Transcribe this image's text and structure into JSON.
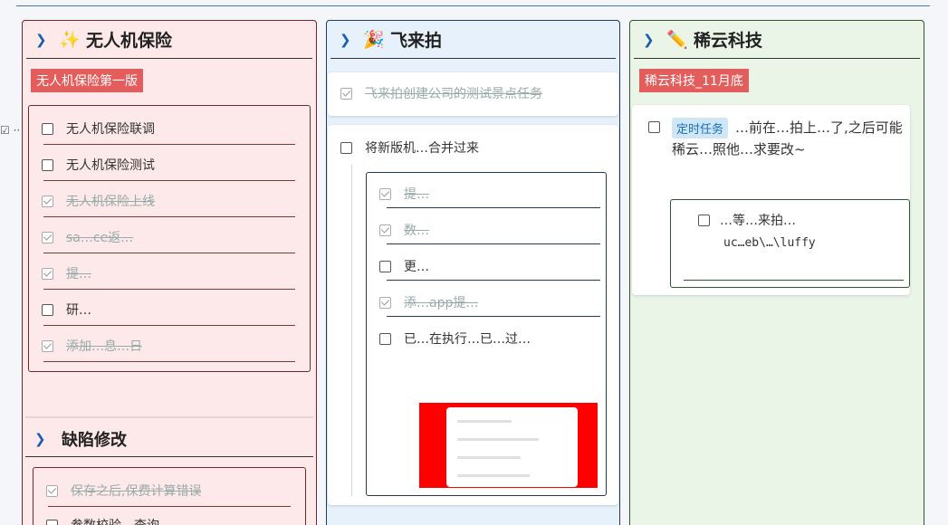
{
  "columns": [
    {
      "title": "无人机保险",
      "icon": "sparkle-icon",
      "emoji": "✨",
      "tag": "无人机保险第一版",
      "tasks": [
        {
          "label": "无人机保险联调",
          "done": false
        },
        {
          "label": "无人机保险测试",
          "done": false
        },
        {
          "label": "无人机保险上线",
          "done": true
        },
        {
          "label": "sa…ce返…",
          "done": true
        },
        {
          "label": "提…",
          "done": true
        },
        {
          "label": "研…",
          "done": false
        },
        {
          "label": "添加…息…日",
          "done": true
        }
      ],
      "section2_title": "缺陷修改",
      "section2_tasks": [
        {
          "label": "保存之后,保费计算错误",
          "done": true
        },
        {
          "label": "参数校验…查询",
          "done": false
        }
      ]
    },
    {
      "title": "飞来拍",
      "icon": "party-icon",
      "emoji": "🎉",
      "top_task": {
        "label": "飞来拍创建公司的测试景点任务",
        "done": true
      },
      "main_task": {
        "label": "将新版机…合并过来",
        "done": false
      },
      "subtasks": [
        {
          "label": "提…",
          "done": true
        },
        {
          "label": "数…",
          "done": true
        },
        {
          "label": "更…",
          "done": false
        },
        {
          "label": "添…app提…",
          "done": true
        },
        {
          "label": "已…在执行…已…过…",
          "done": false
        }
      ]
    },
    {
      "title": "稀云科技",
      "icon": "pencil-icon",
      "emoji": "✏️",
      "tag": "稀云科技_11月底",
      "badge": "定时任务",
      "task_text": "…前在…拍上…了,之后可能稀云…照他…求要改~",
      "sub_task": "…等…来拍…",
      "sub_path": "uc…eb\\…\\luffy"
    }
  ],
  "side_label": "☑ ··"
}
